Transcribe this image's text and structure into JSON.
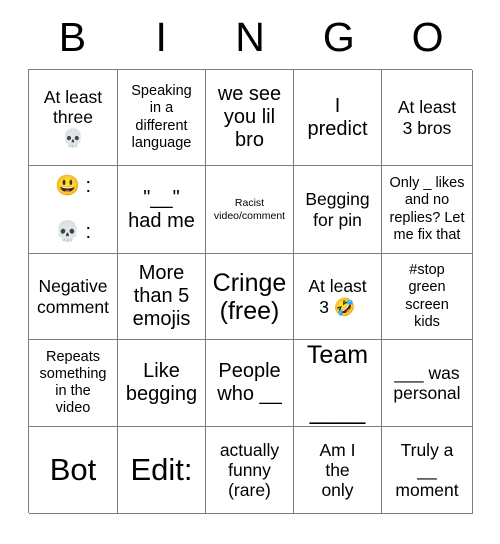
{
  "card": {
    "title": "BINGO",
    "header_letters": [
      "B",
      "I",
      "N",
      "G",
      "O"
    ],
    "grid_size": "5x5",
    "free_space_label": "Cringe (free)",
    "colors": {
      "background": "#ffffff",
      "text": "#000000",
      "grid_line": "#7d7d7d"
    },
    "cells": [
      [
        {
          "text": "At least\nthree\n💀",
          "size": "fs-md"
        },
        {
          "text": "Speaking\nin a\ndifferent\nlanguage",
          "size": "fs-sm"
        },
        {
          "text": "we see\nyou lil\nbro",
          "size": "fs-lg"
        },
        {
          "text": "I\npredict",
          "size": "fs-lg"
        },
        {
          "text": "At least\n3 bros",
          "size": "fs-md"
        }
      ],
      [
        {
          "text": "😃 :\n\n💀 :",
          "size": "fs-lg"
        },
        {
          "text": "\"__\"\nhad me",
          "size": "fs-lg"
        },
        {
          "text": "Racist\nvideo/comment",
          "size": "fs-xs"
        },
        {
          "text": "Begging\nfor pin",
          "size": "fs-md"
        },
        {
          "text": "Only _ likes\nand no\nreplies? Let\nme fix that",
          "size": "fs-sm"
        }
      ],
      [
        {
          "text": "Negative\ncomment",
          "size": "fs-md"
        },
        {
          "text": "More\nthan 5\nemojis",
          "size": "fs-lg"
        },
        {
          "text": "Cringe\n(free)",
          "size": "fs-xl"
        },
        {
          "text": "At least\n3 🤣",
          "size": "fs-md"
        },
        {
          "text": "#stop\ngreen\nscreen\nkids",
          "size": "fs-sm"
        }
      ],
      [
        {
          "text": "Repeats\nsomething\nin the\nvideo",
          "size": "fs-sm"
        },
        {
          "text": "Like\nbegging",
          "size": "fs-lg"
        },
        {
          "text": "People\nwho __",
          "size": "fs-lg"
        },
        {
          "text": "Team\n\n____",
          "size": "fs-xl"
        },
        {
          "text": "___ was\npersonal",
          "size": "fs-md"
        }
      ],
      [
        {
          "text": "Bot",
          "size": "fs-xxl"
        },
        {
          "text": "Edit:",
          "size": "fs-xxl"
        },
        {
          "text": "actually\nfunny\n(rare)",
          "size": "fs-md"
        },
        {
          "text": "Am I\nthe\nonly",
          "size": "fs-md"
        },
        {
          "text": "Truly a\n__\nmoment",
          "size": "fs-md"
        }
      ]
    ]
  }
}
